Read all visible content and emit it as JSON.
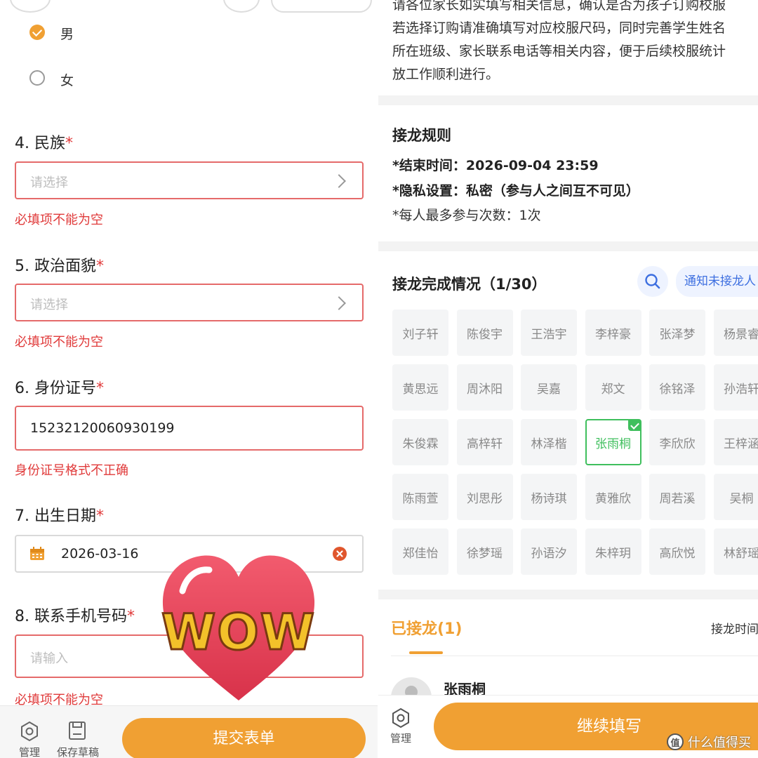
{
  "left": {
    "gender": {
      "options": [
        "男",
        "女"
      ],
      "selected": "男"
    },
    "questions": [
      {
        "label": "4. 民族",
        "placeholder": "请选择",
        "error": "必填项不能为空"
      },
      {
        "label": "5. 政治面貌",
        "placeholder": "请选择",
        "error": "必填项不能为空"
      },
      {
        "label": "6. 身份证号",
        "value": "15232120060930199",
        "error": "身份证号格式不正确"
      },
      {
        "label": "7. 出生日期",
        "value": "2026-03-16"
      },
      {
        "label": "8. 联系手机号码",
        "placeholder": "请输入",
        "error": "必填项不能为空"
      }
    ],
    "required_mark": "*",
    "bottom": {
      "manage_label": "管理",
      "draft_label": "保存草稿",
      "submit_label": "提交表单"
    }
  },
  "sticker": {
    "text": "WOW"
  },
  "right": {
    "intro_lines": [
      "请各位家长如实填写相关信息，确认是否为孩子订购校服",
      "若选择订购请准确填写对应校服尺码，同时完善学生姓名",
      "所在班级、家长联系电话等相关内容，便于后续校服统计",
      "放工作顺利进行。"
    ],
    "rules_title": "接龙规则",
    "rules": [
      "*结束时间：2026-09-04 23:59",
      "*隐私设置：私密（参与人之间互不可见）",
      "*每人最多参与次数：1次"
    ],
    "status_title": "接龙完成情况（1/30）",
    "notify_label": "通知未接龙人",
    "names": [
      [
        "刘子轩",
        "陈俊宇",
        "王浩宇",
        "李梓豪",
        "张泽梦",
        "杨景睿"
      ],
      [
        "黄思远",
        "周沐阳",
        "吴嘉",
        "郑文",
        "徐铭泽",
        "孙浩轩"
      ],
      [
        "朱俊霖",
        "高梓轩",
        "林泽楷",
        "张雨桐",
        "李欣欣",
        "王梓涵"
      ],
      [
        "陈雨萱",
        "刘思彤",
        "杨诗琪",
        "黄雅欣",
        "周若溪",
        "吴桐"
      ],
      [
        "郑佳怡",
        "徐梦瑶",
        "孙语汐",
        "朱梓玥",
        "高欣悦",
        "林舒瑶"
      ]
    ],
    "selected_name": "张雨桐",
    "tab_done": "已接龙(1)",
    "tab_time": "接龙时间",
    "first_entry_name": "张雨桐",
    "bottom": {
      "manage_label": "管理",
      "continue_label": "继续填写"
    },
    "watermark": "什么值得买"
  },
  "colors": {
    "accent": "#f0a033",
    "error": "#e03a3a",
    "selected": "#3fbf5d",
    "link": "#3d6fe0"
  }
}
